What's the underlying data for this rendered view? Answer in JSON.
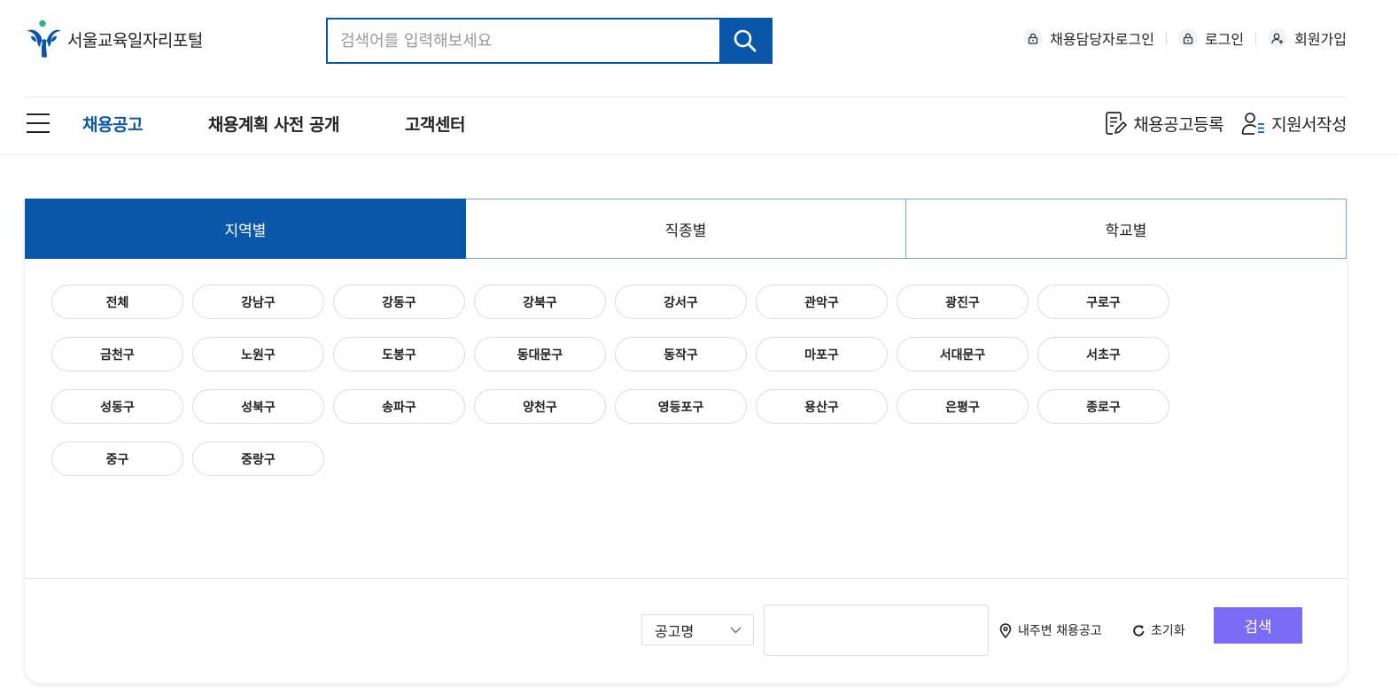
{
  "header": {
    "logo_text": "서울교육일자리포털",
    "search": {
      "placeholder": "검색어를 입력해보세요",
      "value": ""
    },
    "util_links": [
      {
        "label": "채용담당자로그인",
        "icon": "lock-icon"
      },
      {
        "label": "로그인",
        "icon": "lock-icon"
      },
      {
        "label": "회원가입",
        "icon": "user-add-icon"
      }
    ]
  },
  "nav": {
    "items": [
      {
        "label": "채용공고",
        "active": true
      },
      {
        "label": "채용계획 사전 공개",
        "active": false
      },
      {
        "label": "고객센터",
        "active": false
      }
    ],
    "right": [
      {
        "label": "채용공고등록",
        "icon": "document-edit-icon"
      },
      {
        "label": "지원서작성",
        "icon": "user-list-icon"
      }
    ]
  },
  "filter": {
    "tabs": [
      {
        "label": "지역별",
        "active": true
      },
      {
        "label": "직종별",
        "active": false
      },
      {
        "label": "학교별",
        "active": false
      }
    ],
    "districts": [
      "전체",
      "강남구",
      "강동구",
      "강북구",
      "강서구",
      "관악구",
      "광진구",
      "구로구",
      "금천구",
      "노원구",
      "도봉구",
      "동대문구",
      "동작구",
      "마포구",
      "서대문구",
      "서초구",
      "성동구",
      "성북구",
      "송파구",
      "양천구",
      "영등포구",
      "용산구",
      "은평구",
      "종로구",
      "중구",
      "중랑구"
    ]
  },
  "search_bar": {
    "select_value": "공고명",
    "keyword_value": "",
    "near_label": "내주변 채용공고",
    "reset_label": "초기화",
    "submit_label": "검색"
  },
  "colors": {
    "primary": "#0a56a8",
    "accent": "#7b6cf6",
    "logo_green": "#2fb38a"
  }
}
